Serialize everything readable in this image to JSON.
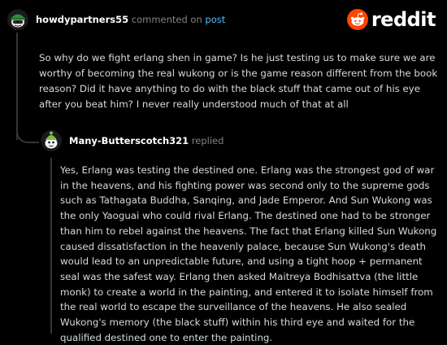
{
  "comment": {
    "username": "howdypartners55",
    "action_text": "commented on",
    "link_text": "post",
    "body": "So why do we fight erlang shen in game? Is he just testing us to make sure we are worthy of becoming the real wukong or is the game reason different from the book reason? Did it have anything to do with the black stuff that came out of his eye after you beat him? I never really understood much of that at all"
  },
  "brand": {
    "wordmark": "reddit",
    "icon": "reddit-snoo-icon",
    "accent": "#ff4500"
  },
  "reply": {
    "username": "Many-Butterscotch321",
    "action_text": "replied",
    "body": "Yes, Erlang was testing the destined one. Erlang was the strongest god of war in the heavens, and his fighting power was second only to the supreme gods such as Tathagata Buddha, Sanqing, and Jade Emperor. And Sun Wukong was the only Yaoguai who could rival Erlang. The destined one had to be stronger than him to rebel against the heavens. The fact that Erlang killed Sun Wukong caused dissatisfaction in the heavenly palace, because Sun Wukong's death would lead to an unpredictable future, and using a tight hoop + permanent seal was the safest way. Erlang then asked Maitreya Bodhisattva (the little monk) to create a world in the painting, and entered it to isolate himself from the real world to escape the surveillance of the heavens. He also sealed Wukong's memory (the black stuff) within his third eye and waited for the qualified destined one to enter the painting."
  },
  "colors": {
    "background": "#000000",
    "text": "#d7dadc",
    "muted": "#818384",
    "link": "#4fbcff",
    "thread": "#343536"
  }
}
